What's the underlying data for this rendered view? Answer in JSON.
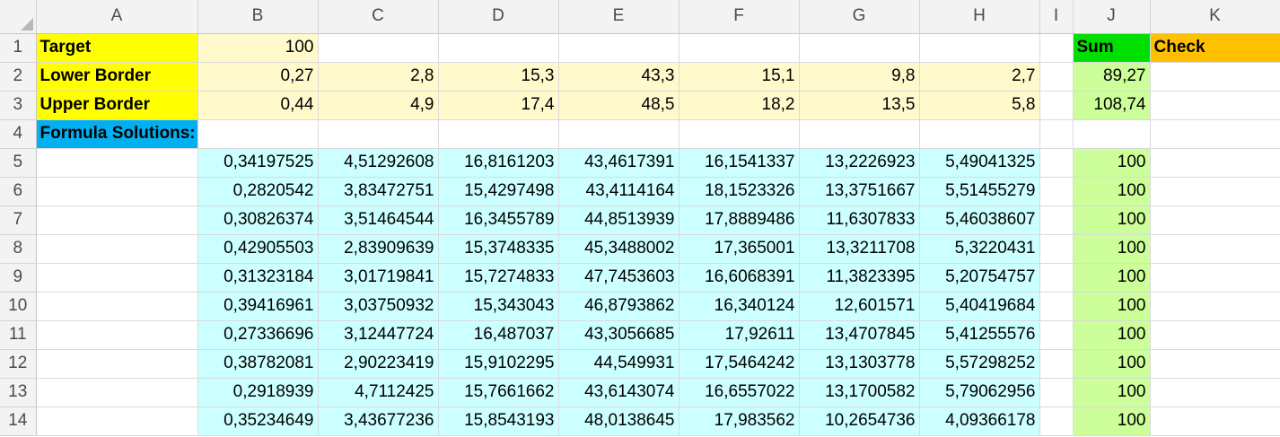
{
  "columns": [
    "A",
    "B",
    "C",
    "D",
    "E",
    "F",
    "G",
    "H",
    "I",
    "J",
    "K"
  ],
  "rows": {
    "r1": {
      "num": "1",
      "A": "Target",
      "B": "100",
      "J": "Sum",
      "K": "Check"
    },
    "r2": {
      "num": "2",
      "A": "Lower Border",
      "B": "0,27",
      "C": "2,8",
      "D": "15,3",
      "E": "43,3",
      "F": "15,1",
      "G": "9,8",
      "H": "2,7",
      "J": "89,27"
    },
    "r3": {
      "num": "3",
      "A": "Upper Border",
      "B": "0,44",
      "C": "4,9",
      "D": "17,4",
      "E": "48,5",
      "F": "18,2",
      "G": "13,5",
      "H": "5,8",
      "J": "108,74"
    },
    "r4": {
      "num": "4",
      "A": "Formula Solutions:"
    },
    "r5": {
      "num": "5",
      "B": "0,34197525",
      "C": "4,51292608",
      "D": "16,8161203",
      "E": "43,4617391",
      "F": "16,1541337",
      "G": "13,2226923",
      "H": "5,49041325",
      "J": "100"
    },
    "r6": {
      "num": "6",
      "B": "0,2820542",
      "C": "3,83472751",
      "D": "15,4297498",
      "E": "43,4114164",
      "F": "18,1523326",
      "G": "13,3751667",
      "H": "5,51455279",
      "J": "100"
    },
    "r7": {
      "num": "7",
      "B": "0,30826374",
      "C": "3,51464544",
      "D": "16,3455789",
      "E": "44,8513939",
      "F": "17,8889486",
      "G": "11,6307833",
      "H": "5,46038607",
      "J": "100"
    },
    "r8": {
      "num": "8",
      "B": "0,42905503",
      "C": "2,83909639",
      "D": "15,3748335",
      "E": "45,3488002",
      "F": "17,365001",
      "G": "13,3211708",
      "H": "5,3220431",
      "J": "100"
    },
    "r9": {
      "num": "9",
      "B": "0,31323184",
      "C": "3,01719841",
      "D": "15,7274833",
      "E": "47,7453603",
      "F": "16,6068391",
      "G": "11,3823395",
      "H": "5,20754757",
      "J": "100"
    },
    "r10": {
      "num": "10",
      "B": "0,39416961",
      "C": "3,03750932",
      "D": "15,343043",
      "E": "46,8793862",
      "F": "16,340124",
      "G": "12,601571",
      "H": "5,40419684",
      "J": "100"
    },
    "r11": {
      "num": "11",
      "B": "0,27336696",
      "C": "3,12447724",
      "D": "16,487037",
      "E": "43,3056685",
      "F": "17,92611",
      "G": "13,4707845",
      "H": "5,41255576",
      "J": "100"
    },
    "r12": {
      "num": "12",
      "B": "0,38782081",
      "C": "2,90223419",
      "D": "15,9102295",
      "E": "44,549931",
      "F": "17,5464242",
      "G": "13,1303778",
      "H": "5,57298252",
      "J": "100"
    },
    "r13": {
      "num": "13",
      "B": "0,2918939",
      "C": "4,7112425",
      "D": "15,7661662",
      "E": "43,6143074",
      "F": "16,6557022",
      "G": "13,1700582",
      "H": "5,79062956",
      "J": "100"
    },
    "r14": {
      "num": "14",
      "B": "0,35234649",
      "C": "3,43677236",
      "D": "15,8543193",
      "E": "48,0138645",
      "F": "17,983562",
      "G": "10,2654736",
      "H": "4,09366178",
      "J": "100"
    }
  },
  "colors": {
    "label_yellow": "#ffff00",
    "border_values": "#fff9cc",
    "formula_header": "#00b0f0",
    "solutions": "#ccffff",
    "sum_header": "#00e000",
    "sum_values": "#ccff99",
    "check_header": "#ffc000"
  }
}
